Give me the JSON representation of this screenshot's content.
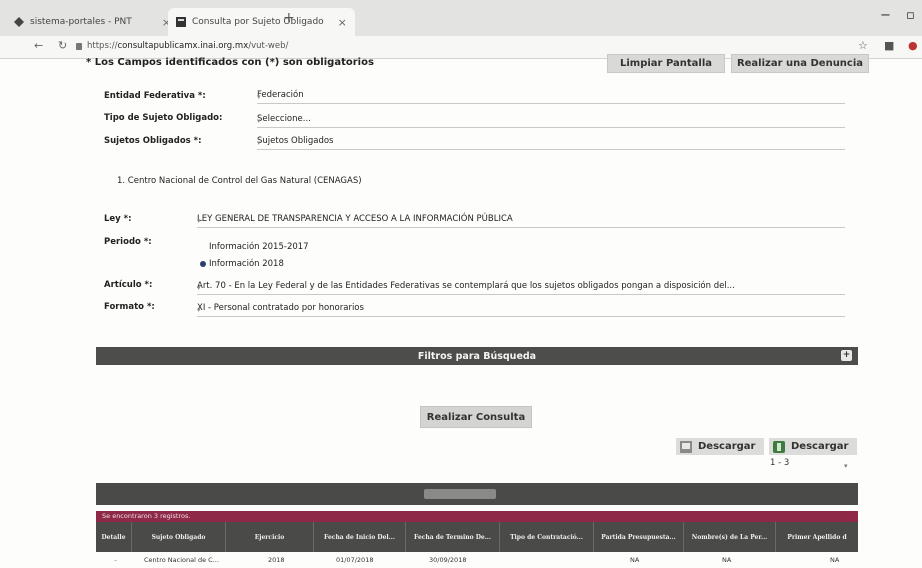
{
  "browser": {
    "tabs": [
      {
        "label": "sistema-portales - PNT"
      },
      {
        "label": "Consulta por Sujeto Obligado"
      }
    ],
    "url_prefix": "https://",
    "url_host": "consultapublicamx.inai.org.mx",
    "url_path": "/vut-web/"
  },
  "form": {
    "required_note": "* Los Campos identificados con (*) son obligatorios",
    "clear_button": "Limpiar Pantalla",
    "complaint_button": "Realizar una Denuncia",
    "entidad_label": "Entidad Federativa *:",
    "entidad_value": "Federación",
    "tipo_label": "Tipo de Sujeto Obligado:",
    "tipo_value": "Seleccione...",
    "sujetos_label": "Sujetos Obligados *:",
    "sujetos_value": "Sujetos Obligados",
    "selected_subject": "1. Centro Nacional de Control del Gas Natural (CENAGAS)",
    "ley_label": "Ley *:",
    "ley_value": "LEY GENERAL DE TRANSPARENCIA Y ACCESO A LA INFORMACIÓN PÚBLICA",
    "periodo_label": "Periodo *:",
    "periodo_options": [
      "Información 2015-2017",
      "Información 2018"
    ],
    "articulo_label": "Artículo *:",
    "articulo_value": "Art. 70 - En la Ley Federal y de las Entidades Federativas se contemplará que los sujetos obligados pongan a disposición del...",
    "formato_label": "Formato *:",
    "formato_value": "XI - Personal contratado por honorarios"
  },
  "filters": {
    "title": "Filtros para Búsqueda",
    "toggle": "+"
  },
  "consult_button": "Realizar Consulta",
  "downloads": [
    {
      "label": "Descargar"
    },
    {
      "label": "Descargar"
    }
  ],
  "pager": "1 - 3",
  "results": {
    "found_text": "Se encontraron 3 registros.",
    "columns": [
      "Detalle",
      "Sujeto Obligado",
      "Ejercicio",
      "Fecha de Inicio Del...",
      "Fecha de Termino De...",
      "Tipo de Contratació...",
      "Partida Presupuesta...",
      "Nombre(s) de La Per...",
      "Primer Apellido d"
    ],
    "row": [
      "Centro Nacional de C...",
      "2018",
      "01/07/2018",
      "30/09/2018",
      "NA",
      "NA",
      "NA"
    ]
  },
  "colors": {
    "filter_bar": "#4d4d4b",
    "found_bar": "#8e2a48",
    "grid_header": "#4a4a48"
  }
}
